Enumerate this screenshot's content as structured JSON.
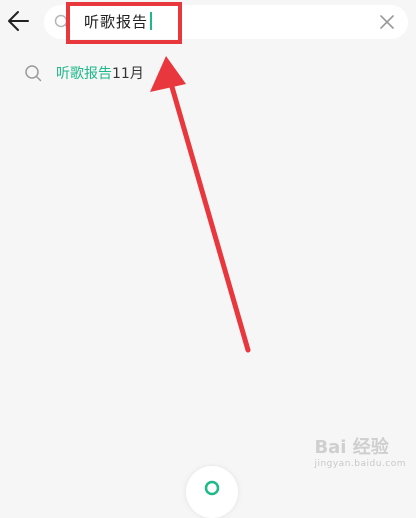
{
  "search": {
    "query": "听歌报告",
    "accent_color": "#1fb88a"
  },
  "icons": {
    "back": "arrow-left-icon",
    "search": "search-icon",
    "clear": "close-icon"
  },
  "suggestions": [
    {
      "match": "听歌报告",
      "rest": "11月"
    }
  ],
  "annotation": {
    "highlight_color": "#e8383d"
  },
  "watermark": {
    "text": "Bai 经验",
    "sub": "jingyan.baidu.com"
  }
}
